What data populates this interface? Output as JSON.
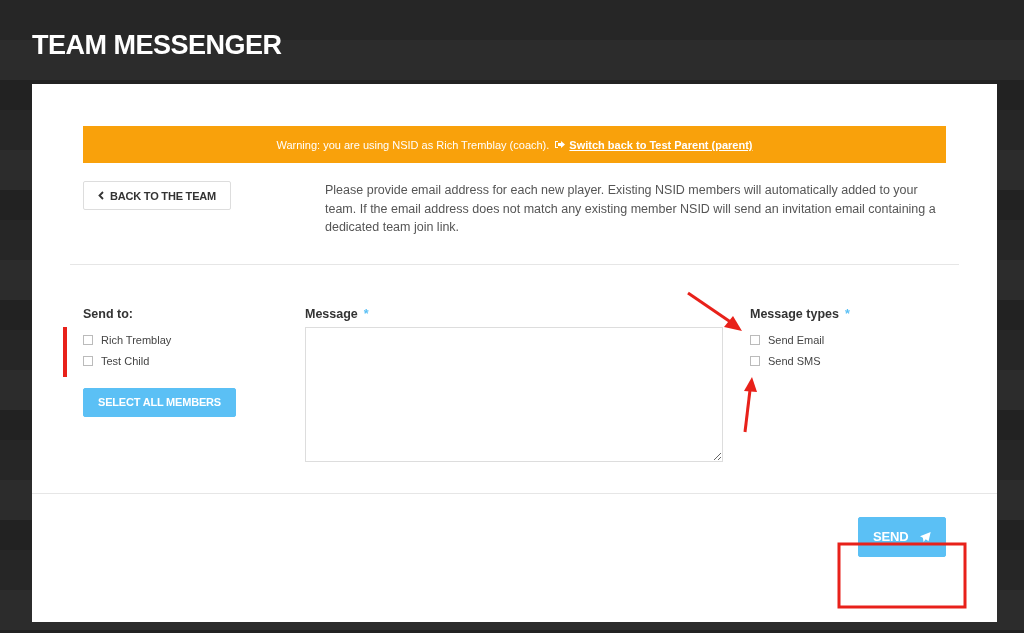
{
  "page": {
    "title": "TEAM MESSENGER"
  },
  "warning": {
    "text": "Warning: you are using NSID as Rich Tremblay (coach).",
    "link": "Switch back to Test Parent (parent)"
  },
  "back_button": "BACK TO THE TEAM",
  "intro": "Please provide email address for each new player. Existing NSID members will automatically added to your team. If the email address does not match any existing member NSID will send an invitation email containing a dedicated team join link.",
  "send_to": {
    "label": "Send to:",
    "members": [
      {
        "name": "Rich Tremblay",
        "checked": false
      },
      {
        "name": "Test Child",
        "checked": false
      }
    ],
    "select_all": "SELECT ALL MEMBERS"
  },
  "message": {
    "label": "Message",
    "required_mark": "*"
  },
  "message_types": {
    "label": "Message types",
    "required_mark": "*",
    "options": [
      {
        "name": "Send Email",
        "checked": false
      },
      {
        "name": "Send SMS",
        "checked": false
      }
    ]
  },
  "send_button": "SEND"
}
